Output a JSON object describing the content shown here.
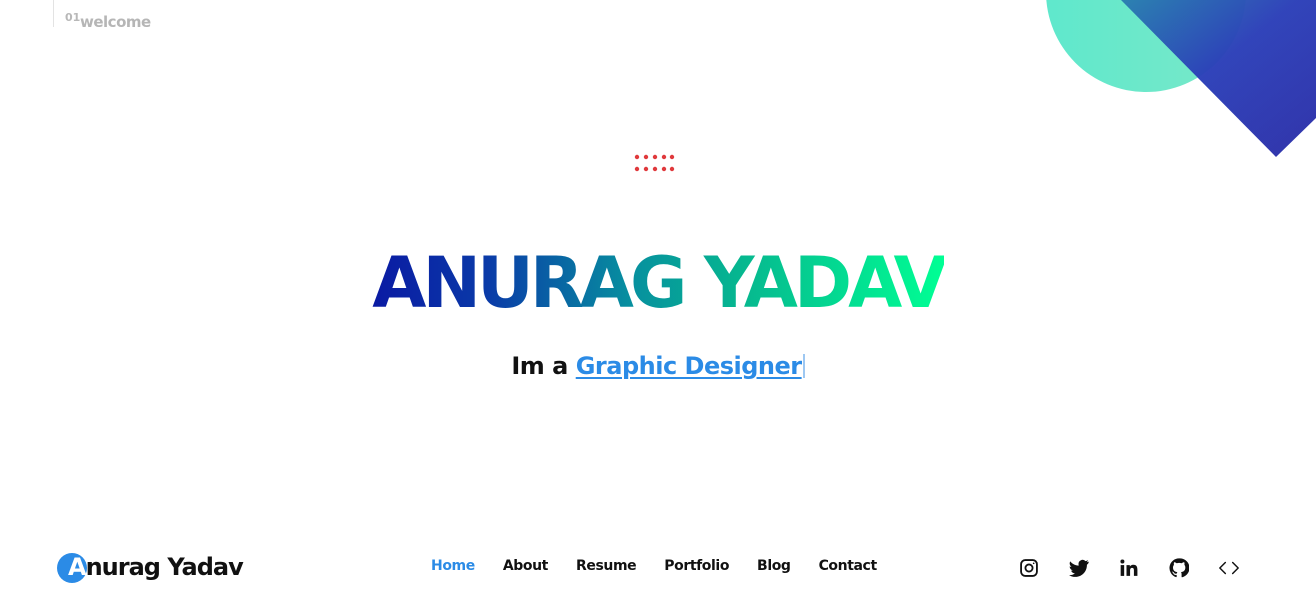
{
  "section": {
    "number": "01",
    "label": "welcome"
  },
  "hero": {
    "name_first": "ANURAG",
    "name_last": "YADAV",
    "prefix": "Im a",
    "role": "Graphic Designer"
  },
  "logo": {
    "first_letter": "A",
    "rest": "nurag Yadav"
  },
  "nav": {
    "items": [
      {
        "label": "Home",
        "active": true
      },
      {
        "label": "About",
        "active": false
      },
      {
        "label": "Resume",
        "active": false
      },
      {
        "label": "Portfolio",
        "active": false
      },
      {
        "label": "Blog",
        "active": false
      },
      {
        "label": "Contact",
        "active": false
      }
    ]
  },
  "socials": [
    "instagram-icon",
    "twitter-icon",
    "linkedin-icon",
    "github-icon",
    "code-icon"
  ],
  "colors": {
    "accent": "#2b8be6",
    "dots": "#e0393c",
    "circle": "#66e6c8",
    "diamond": "#2b32b2",
    "gradient_start": "#0a1aa3",
    "gradient_end": "#00ff94"
  }
}
